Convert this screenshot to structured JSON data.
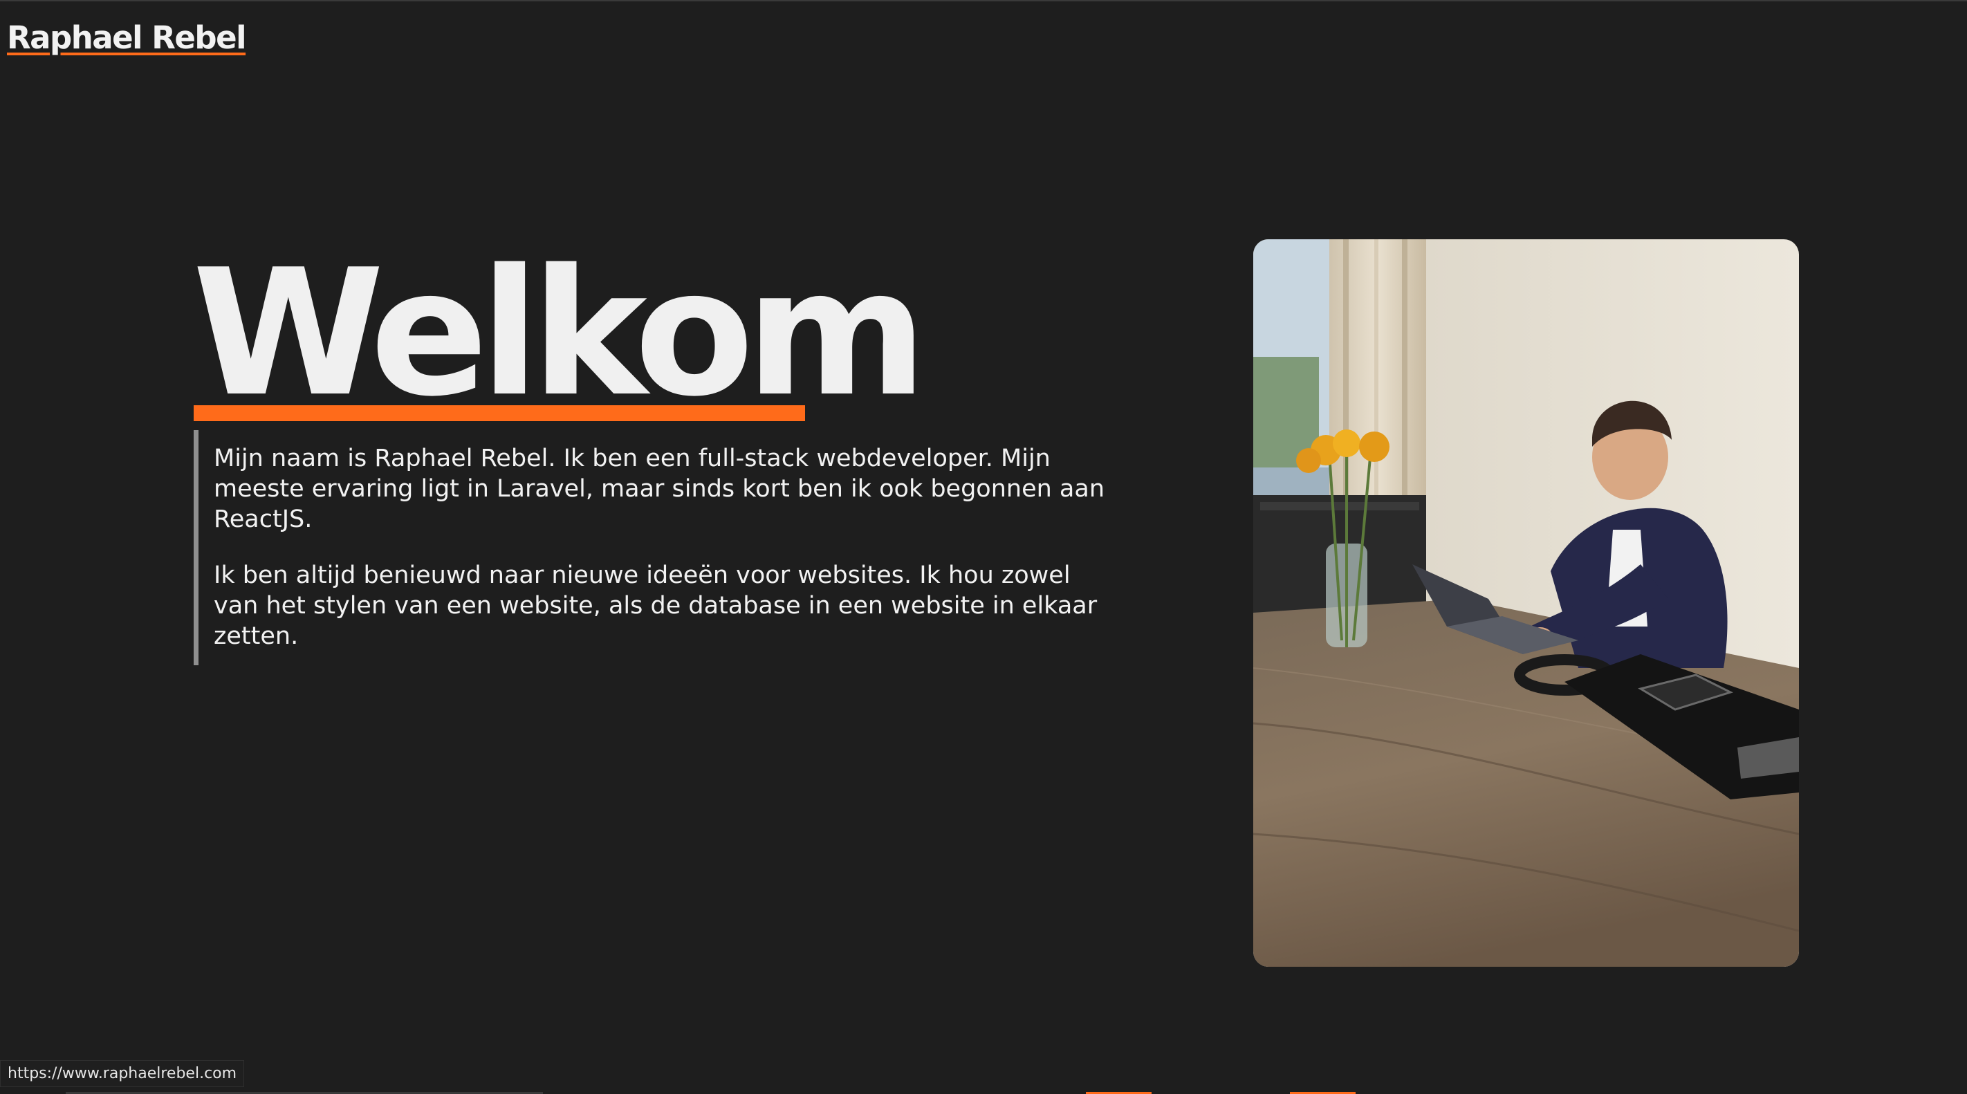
{
  "header": {
    "brand": "Raphael Rebel"
  },
  "hero": {
    "title": "Welkom",
    "paragraphs": [
      "Mijn naam is Raphael Rebel. Ik ben een full-stack webdeveloper. Mijn meeste ervaring ligt in Laravel, maar sinds kort ben ik ook begonnen aan ReactJS.",
      "Ik ben altijd benieuwd naar nieuwe ideeën voor websites. Ik hou zowel van het stylen van een website, als de database in een website in elkaar zetten."
    ]
  },
  "status_bar": {
    "url": "https://www.raphaelrebel.com"
  },
  "colors": {
    "background": "#1e1e1e",
    "accent": "#ff6b1a",
    "text": "#f2f2f2"
  }
}
